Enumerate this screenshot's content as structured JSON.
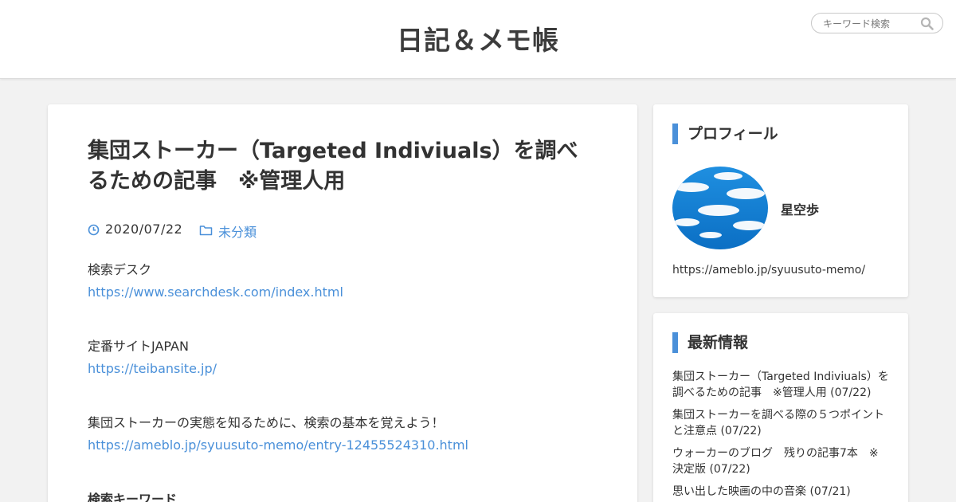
{
  "header": {
    "site_title": "日記＆メモ帳",
    "search_placeholder": "キーワード検索"
  },
  "article": {
    "title": "集団ストーカー（Targeted Indiviuals）を調べるための記事　※管理人用",
    "date": "2020/07/22",
    "category": "未分類",
    "body": {
      "label1": "検索デスク",
      "link1": "https://www.searchdesk.com/index.html",
      "label2": "定番サイトJAPAN",
      "link2": "https://teibansite.jp/",
      "label3": "集団ストーカーの実態を知るために、検索の基本を覚えよう！",
      "link3": "https://ameblo.jp/syuusuto-memo/entry-12455524310.html",
      "heading4": "検索キーワード"
    }
  },
  "sidebar": {
    "profile": {
      "heading": "プロフィール",
      "name": "星空歩",
      "url": "https://ameblo.jp/syuusuto-memo/"
    },
    "latest": {
      "heading": "最新情報",
      "items": [
        {
          "label": "集団ストーカー（Targeted Indiviuals）を調べるための記事　※管理人用 (07/22)"
        },
        {
          "label": "集団ストーカーを調べる際の５つポイントと注意点 (07/22)"
        },
        {
          "label": "ウォーカーのブログ　残りの記事7本　※決定版 (07/22)"
        },
        {
          "label": "思い出した映画の中の音楽 (07/21)"
        }
      ]
    }
  },
  "colors": {
    "accent": "#4a90d9",
    "text": "#333333",
    "background": "#f2f2f2",
    "card": "#ffffff"
  },
  "icons": {
    "search": "search-icon",
    "date": "clock-icon",
    "category": "folder-icon"
  }
}
